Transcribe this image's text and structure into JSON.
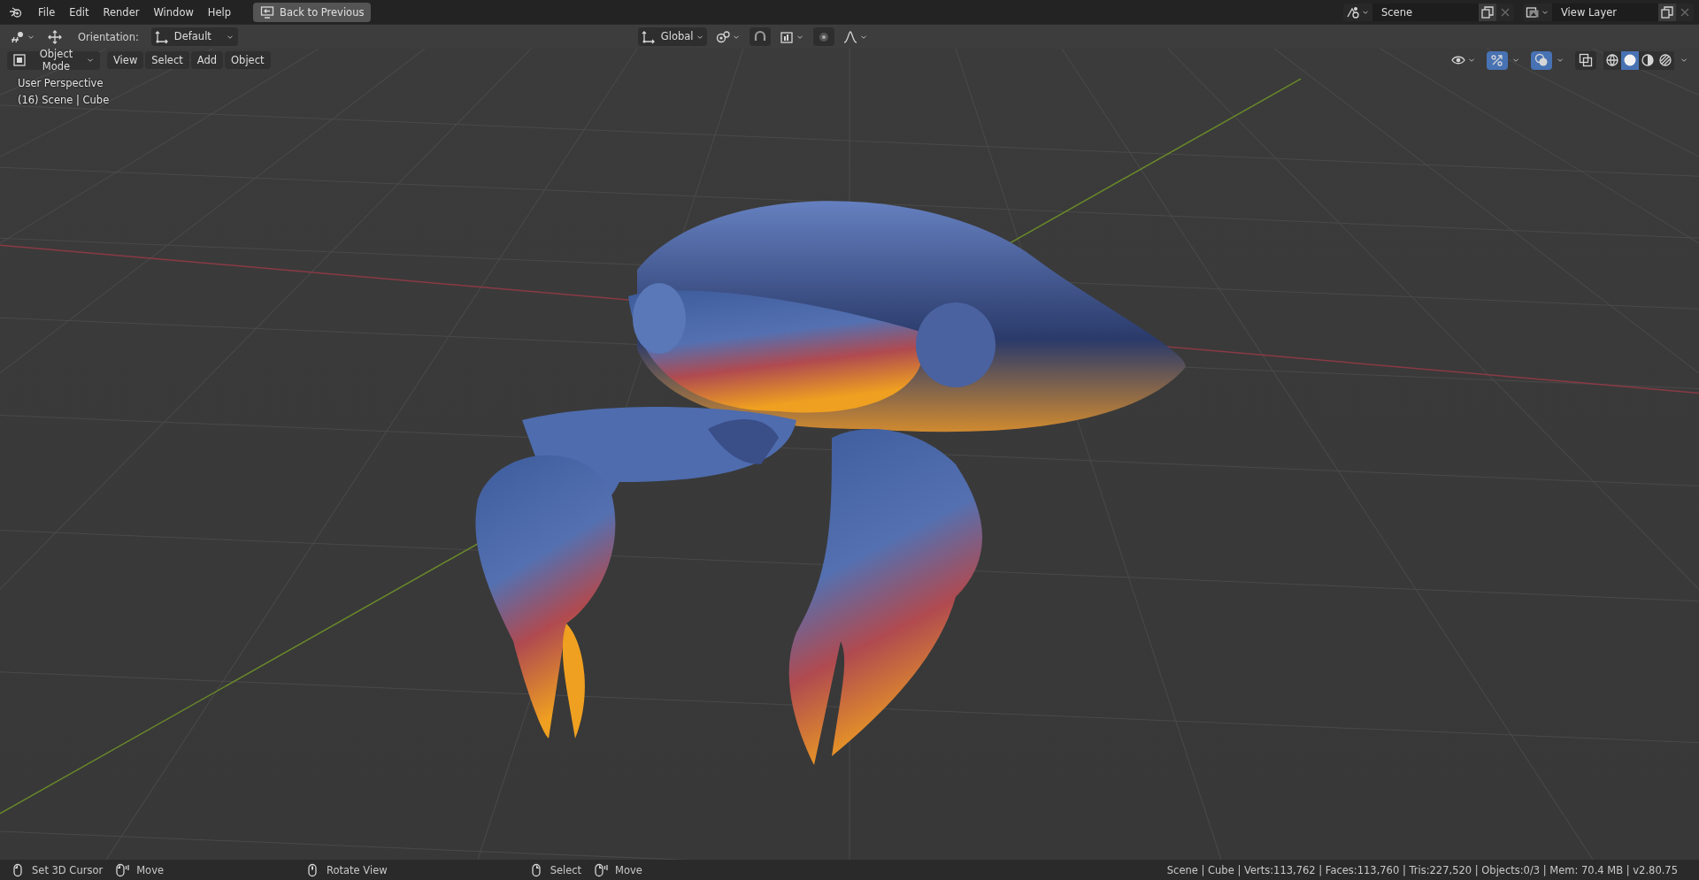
{
  "top_bar": {
    "menus": [
      "File",
      "Edit",
      "Render",
      "Window",
      "Help"
    ],
    "back_button": "Back to Previous",
    "scene": {
      "value": "Scene"
    },
    "view_layer": {
      "value": "View Layer"
    }
  },
  "tool_header": {
    "orientation_label": "Orientation:",
    "orientation": "Default",
    "transform_orientation": "Global",
    "snap": {
      "on": false
    },
    "proportional_editing": {
      "on": false
    }
  },
  "viewport_header": {
    "mode": "Object Mode",
    "menus": [
      "View",
      "Select",
      "Add",
      "Object"
    ],
    "gizmos": {
      "on": true
    },
    "overlays": {
      "on": true
    },
    "xray": {
      "on": false
    },
    "shading": [
      {
        "kind": "wireframe",
        "selected": false
      },
      {
        "kind": "solid",
        "selected": true
      },
      {
        "kind": "material",
        "selected": false
      },
      {
        "kind": "rendered",
        "selected": false
      }
    ]
  },
  "viewport": {
    "view_name": "User Perspective",
    "object_info": "(16) Scene | Cube"
  },
  "status_bar": {
    "hints": [
      {
        "kind": "left",
        "label": "Set 3D Cursor"
      },
      {
        "kind": "left-drag",
        "label": "Move"
      },
      {
        "kind": "middle",
        "label": "Rotate View"
      },
      {
        "kind": "right",
        "label": "Select"
      },
      {
        "kind": "right-drag",
        "label": "Move"
      }
    ],
    "stats": "Scene | Cube | Verts:113,762 | Faces:113,760 | Tris:227,520 | Objects:0/3 | Mem: 70.4 MB | v2.80.75"
  }
}
